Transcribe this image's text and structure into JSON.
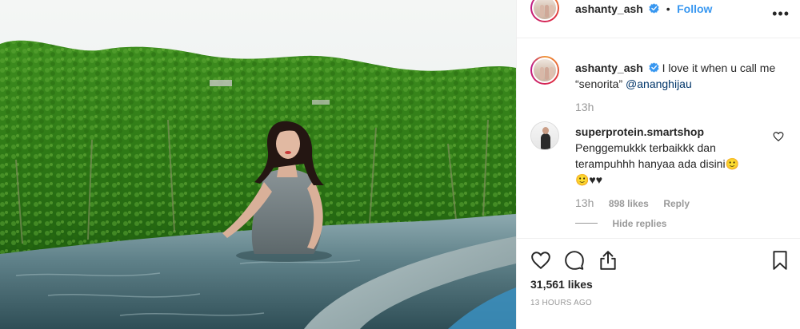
{
  "post": {
    "author": "ashanty_ash",
    "verified": true,
    "separator": "•",
    "follow_label": "Follow",
    "more_label": "•••"
  },
  "caption": {
    "author": "ashanty_ash",
    "text_line1": "I love it when u call me",
    "text_line2": "“senorita”",
    "mention": "@ananghijau",
    "time": "13h"
  },
  "comment": {
    "author": "superprotein.smartshop",
    "line1": "Penggemukkk terbaikkk dan",
    "line2": "terampuhhh hanyaa ada disini🙂",
    "line3": "🙂♥♥",
    "time": "13h",
    "likes": "898 likes",
    "reply_label": "Reply",
    "hide_replies_label": "Hide replies"
  },
  "footer": {
    "likes": "31,561 likes",
    "timestamp": "13 HOURS AGO"
  },
  "icons": [
    "heart-icon",
    "comment-icon",
    "share-icon",
    "bookmark-icon",
    "verified-icon",
    "more-icon"
  ],
  "colors": {
    "link": "#3897f0",
    "mention": "#003569",
    "muted": "#999999",
    "verified": "#3897f0"
  }
}
